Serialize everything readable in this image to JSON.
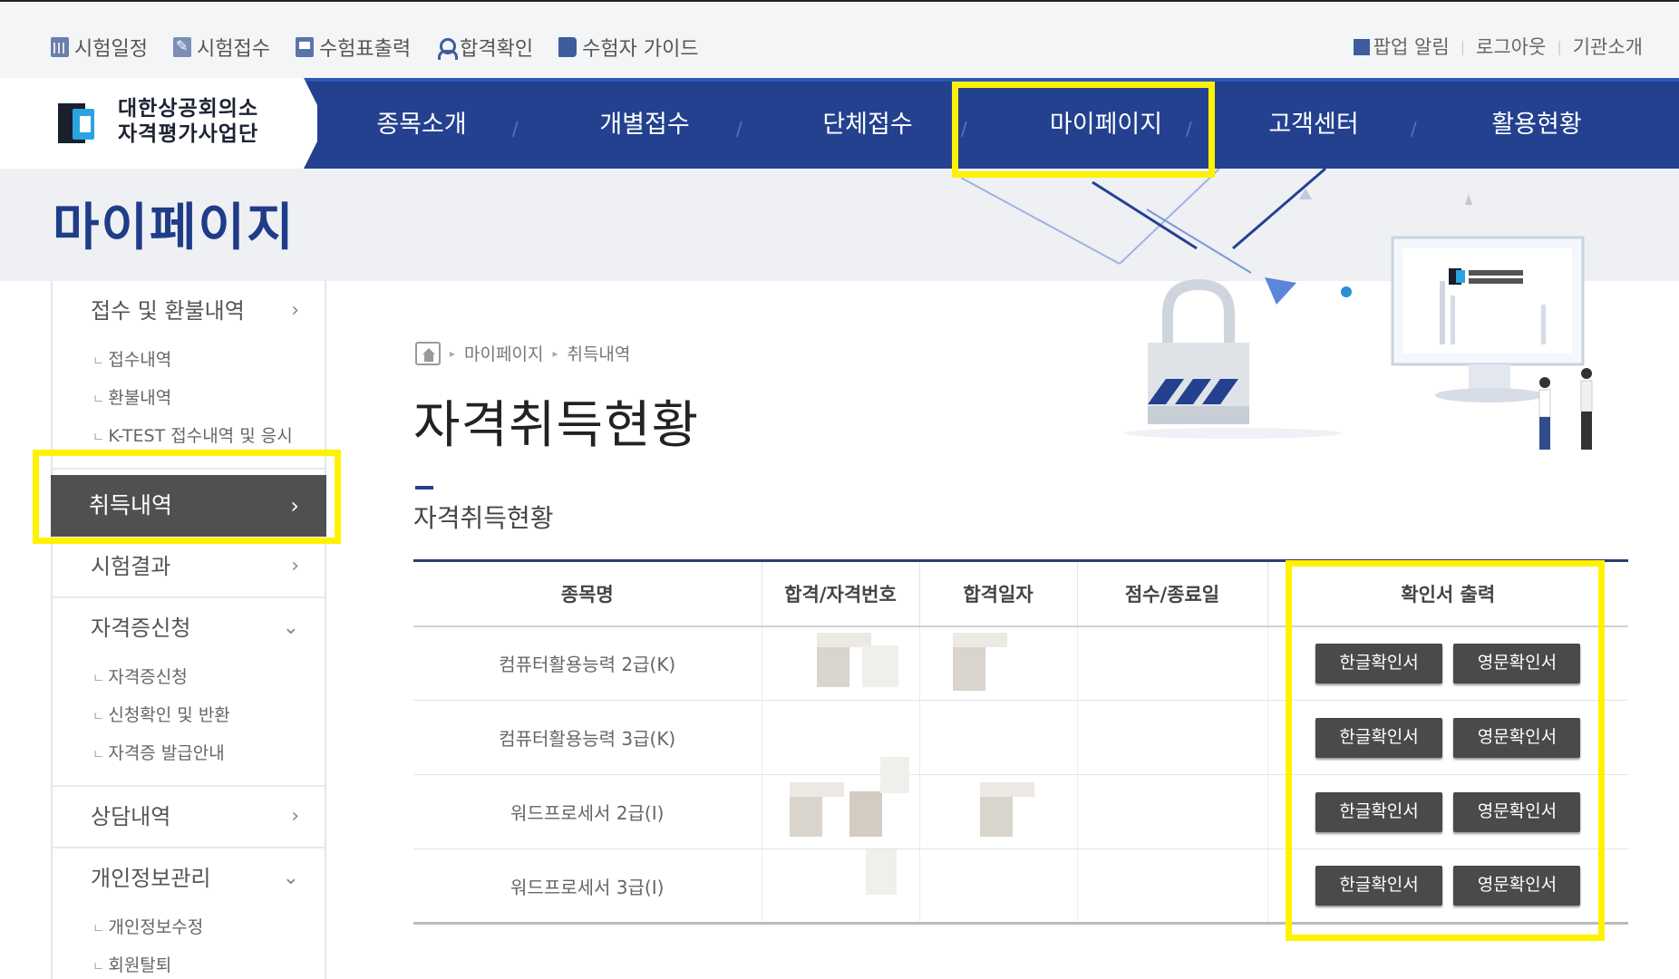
{
  "utility_bar": {
    "left_items": [
      {
        "label": "시험일정",
        "icon": "calendar-icon"
      },
      {
        "label": "시험접수",
        "icon": "edit-icon"
      },
      {
        "label": "수험표출력",
        "icon": "print-icon"
      },
      {
        "label": "합격확인",
        "icon": "user-icon"
      },
      {
        "label": "수험자 가이드",
        "icon": "book-icon"
      }
    ],
    "right_items": [
      {
        "label": "팝업 알림"
      },
      {
        "label": "로그아웃"
      },
      {
        "label": "기관소개"
      }
    ]
  },
  "logo": {
    "line1": "대한상공회의소",
    "line2": "자격평가사업단"
  },
  "nav": {
    "items": [
      {
        "label": "종목소개"
      },
      {
        "label": "개별접수"
      },
      {
        "label": "단체접수"
      },
      {
        "label": "마이페이지"
      },
      {
        "label": "고객센터"
      },
      {
        "label": "활용현황"
      }
    ]
  },
  "page": {
    "heading": "마이페이지"
  },
  "sidebar": {
    "groups": [
      {
        "label": "접수 및 환불내역",
        "chevron": "›",
        "subs": [
          "접수내역",
          "환불내역",
          "K-TEST 접수내역 및 응시"
        ]
      },
      {
        "label": "취득내역",
        "chevron": "›",
        "active": true
      },
      {
        "label": "시험결과",
        "chevron": "›"
      },
      {
        "label": "자격증신청",
        "chevron": "⌄",
        "subs": [
          "자격증신청",
          "신청확인 및 반환",
          "자격증 발급안내"
        ]
      },
      {
        "label": "상담내역",
        "chevron": "›"
      },
      {
        "label": "개인정보관리",
        "chevron": "⌄",
        "subs": [
          "개인정보수정",
          "회원탈퇴"
        ]
      }
    ]
  },
  "breadcrumb": {
    "items": [
      "마이페이지",
      "취득내역"
    ]
  },
  "content": {
    "title": "자격취득현황",
    "subtitle": "자격취득현황"
  },
  "table": {
    "headers": [
      "종목명",
      "합격/자격번호",
      "합격일자",
      "점수/종료일",
      "확인서 출력"
    ],
    "rows": [
      {
        "name": "컴퓨터활용능력 2급(K)",
        "kor_btn": "한글확인서",
        "eng_btn": "영문확인서"
      },
      {
        "name": "컴퓨터활용능력 3급(K)",
        "kor_btn": "한글확인서",
        "eng_btn": "영문확인서"
      },
      {
        "name": "워드프로세서 2급(I)",
        "kor_btn": "한글확인서",
        "eng_btn": "영문확인서"
      },
      {
        "name": "워드프로세서 3급(I)",
        "kor_btn": "한글확인서",
        "eng_btn": "영문확인서"
      }
    ]
  },
  "colors": {
    "nav_bg": "#23418f",
    "heading": "#1f3c88",
    "highlight": "#fff200",
    "active_side": "#505050"
  }
}
